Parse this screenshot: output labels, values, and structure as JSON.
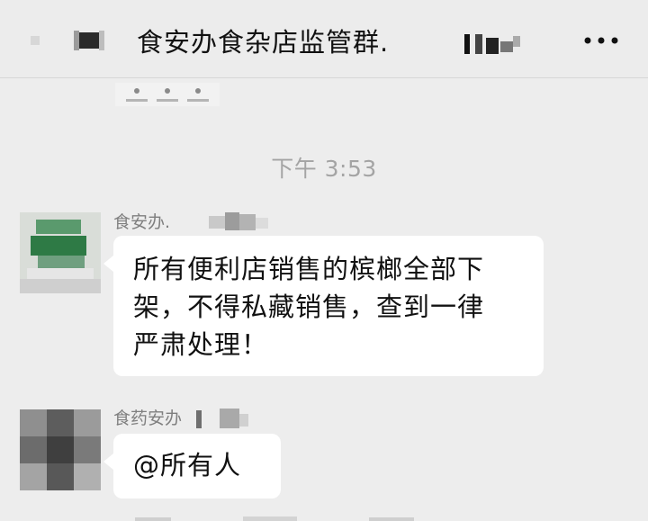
{
  "header": {
    "title": "食安办食杂店监管群.",
    "more_icon": "more-dots-icon",
    "back_icon": "back-arrow-icon"
  },
  "timestamp": "下午 3:53",
  "messages": [
    {
      "sender": "食安办.",
      "text_lines": [
        "所有便利店销售的槟榔全部下",
        "架，不得私藏销售，查到一律",
        "严肃处理！"
      ]
    },
    {
      "sender": "食药安办",
      "text": "@所有人"
    }
  ],
  "colors": {
    "background": "#ededed",
    "bubble": "#ffffff",
    "timestamp": "#a4a4a4",
    "sender_name": "#7f7f7f"
  }
}
